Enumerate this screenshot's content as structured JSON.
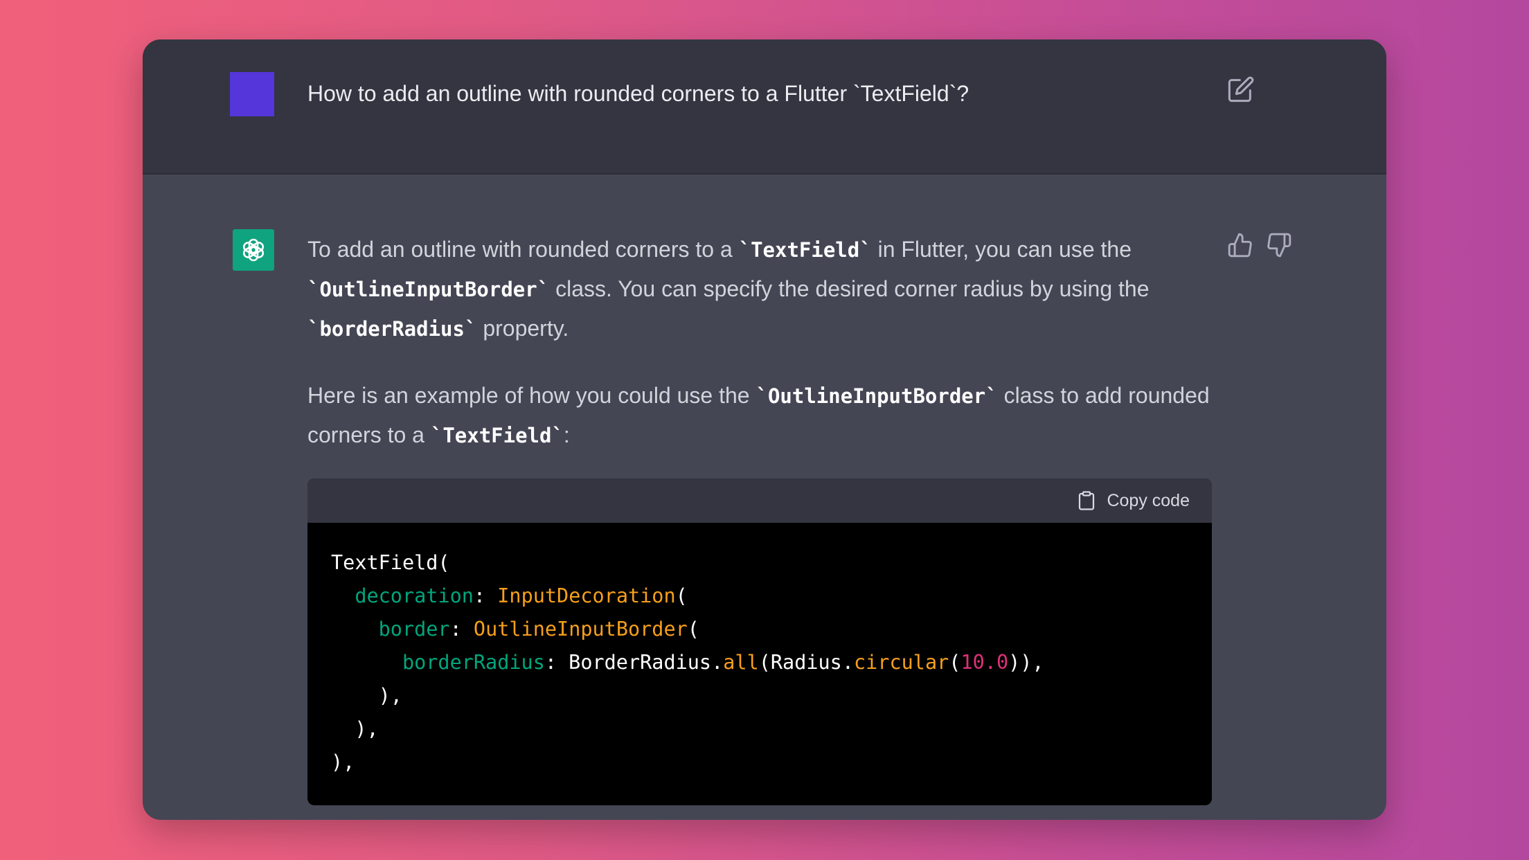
{
  "user_message": {
    "text": "How to add an outline with rounded corners to a Flutter `TextField`?",
    "avatar_color": "#5436da"
  },
  "assistant_message": {
    "avatar_color": "#10a37f",
    "paragraph1": {
      "t1": "To add an outline with rounded corners to a ",
      "c1": "`TextField`",
      "t2": " in Flutter, you can use the ",
      "c2": "`OutlineInputBorder`",
      "t3": " class. You can specify the desired corner radius by using the ",
      "c3": "`borderRadius`",
      "t4": " property."
    },
    "paragraph2": {
      "t1": "Here is an example of how you could use the ",
      "c1": "`OutlineInputBorder`",
      "t2": " class to add rounded corners to a ",
      "c2": "`TextField`",
      "t3": ":"
    }
  },
  "code_block": {
    "copy_label": "Copy code",
    "lines": {
      "l1": "TextField(",
      "l2_indent": "  ",
      "l2_attr": "decoration",
      "l2_sep": ": ",
      "l2_cls": "InputDecoration",
      "l2_end": "(",
      "l3_indent": "    ",
      "l3_attr": "border",
      "l3_sep": ": ",
      "l3_cls": "OutlineInputBorder",
      "l3_end": "(",
      "l4_indent": "      ",
      "l4_attr": "borderRadius",
      "l4_sep": ": BorderRadius.",
      "l4_fn1": "all",
      "l4_mid": "(Radius.",
      "l4_fn2": "circular",
      "l4_open": "(",
      "l4_num": "10.0",
      "l4_end": ")),",
      "l5": "    ),",
      "l6": "  ),",
      "l7": "),"
    },
    "colors": {
      "attribute": "#00a67d",
      "class": "#f79f1c",
      "number": "#df3079"
    }
  },
  "icons": {
    "edit": "edit-icon",
    "thumbs_up": "thumbs-up-icon",
    "thumbs_down": "thumbs-down-icon",
    "clipboard": "clipboard-icon",
    "assistant_logo": "openai-logo-icon"
  }
}
